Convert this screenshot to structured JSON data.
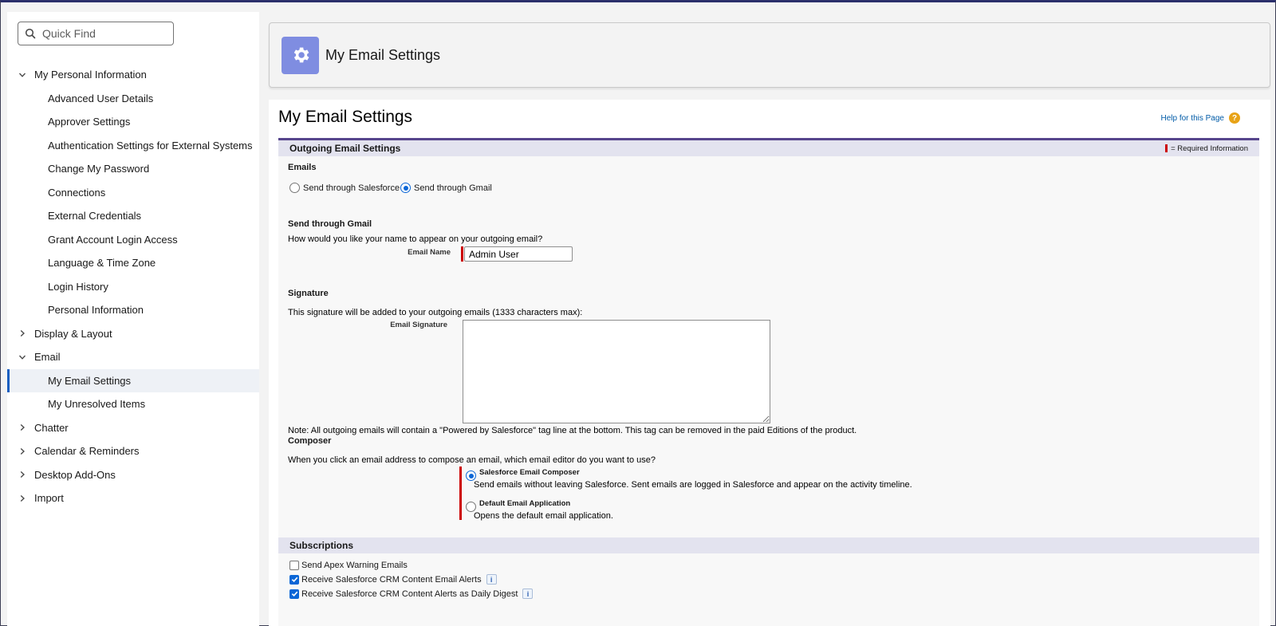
{
  "sidebar": {
    "quick_find_placeholder": "Quick Find",
    "items": [
      {
        "label": "My Personal Information",
        "level": "top",
        "expanded": true
      },
      {
        "label": "Advanced User Details",
        "level": "sub"
      },
      {
        "label": "Approver Settings",
        "level": "sub"
      },
      {
        "label": "Authentication Settings for External Systems",
        "level": "sub"
      },
      {
        "label": "Change My Password",
        "level": "sub"
      },
      {
        "label": "Connections",
        "level": "sub"
      },
      {
        "label": "External Credentials",
        "level": "sub"
      },
      {
        "label": "Grant Account Login Access",
        "level": "sub"
      },
      {
        "label": "Language & Time Zone",
        "level": "sub"
      },
      {
        "label": "Login History",
        "level": "sub"
      },
      {
        "label": "Personal Information",
        "level": "sub"
      },
      {
        "label": "Display & Layout",
        "level": "top",
        "expanded": false
      },
      {
        "label": "Email",
        "level": "top",
        "expanded": true
      },
      {
        "label": "My Email Settings",
        "level": "sub",
        "active": true
      },
      {
        "label": "My Unresolved Items",
        "level": "sub"
      },
      {
        "label": "Chatter",
        "level": "top",
        "expanded": false
      },
      {
        "label": "Calendar & Reminders",
        "level": "top",
        "expanded": false
      },
      {
        "label": "Desktop Add-Ons",
        "level": "top",
        "expanded": false
      },
      {
        "label": "Import",
        "level": "top",
        "expanded": false
      }
    ]
  },
  "header": {
    "title": "My Email Settings",
    "icon": "gear-icon",
    "icon_bg": "#7f8de1"
  },
  "main": {
    "page_title": "My Email Settings",
    "help_link": "Help for this Page",
    "section_title": "Outgoing Email Settings",
    "required_legend": " = Required Information",
    "emails_label": "Emails",
    "radio_salesforce": "Send through Salesforce",
    "radio_gmail": "Send through Gmail",
    "gmail_heading": "Send through Gmail",
    "name_question": "How would you like your name to appear on your outgoing email?",
    "email_name_label": "Email Name",
    "email_name_value": "Admin User",
    "signature_heading": "Signature",
    "signature_desc": "This signature will be added to your outgoing emails (1333 characters max):",
    "signature_label": "Email Signature",
    "signature_value": "",
    "note": "Note: All outgoing emails will contain a \"Powered by Salesforce\" tag line at the bottom. This tag can be removed in the paid Editions of the product.",
    "composer_heading": "Composer",
    "composer_question": "When you click an email address to compose an email, which email editor do you want to use?",
    "composer_opt1_title": "Salesforce Email Composer",
    "composer_opt1_desc": "Send emails without leaving Salesforce. Sent emails are logged in Salesforce and appear on the activity timeline.",
    "composer_opt2_title": "Default Email Application",
    "composer_opt2_desc": "Opens the default email application.",
    "subscriptions_title": "Subscriptions",
    "sub_apex": "Send Apex Warning Emails",
    "sub_content_alerts": "Receive Salesforce CRM Content Email Alerts",
    "sub_daily_digest": "Receive Salesforce CRM Content Alerts as Daily Digest"
  },
  "colors": {
    "accent": "#0b66d6",
    "required": "#cc0000",
    "section_header": "#e3e3ef"
  }
}
